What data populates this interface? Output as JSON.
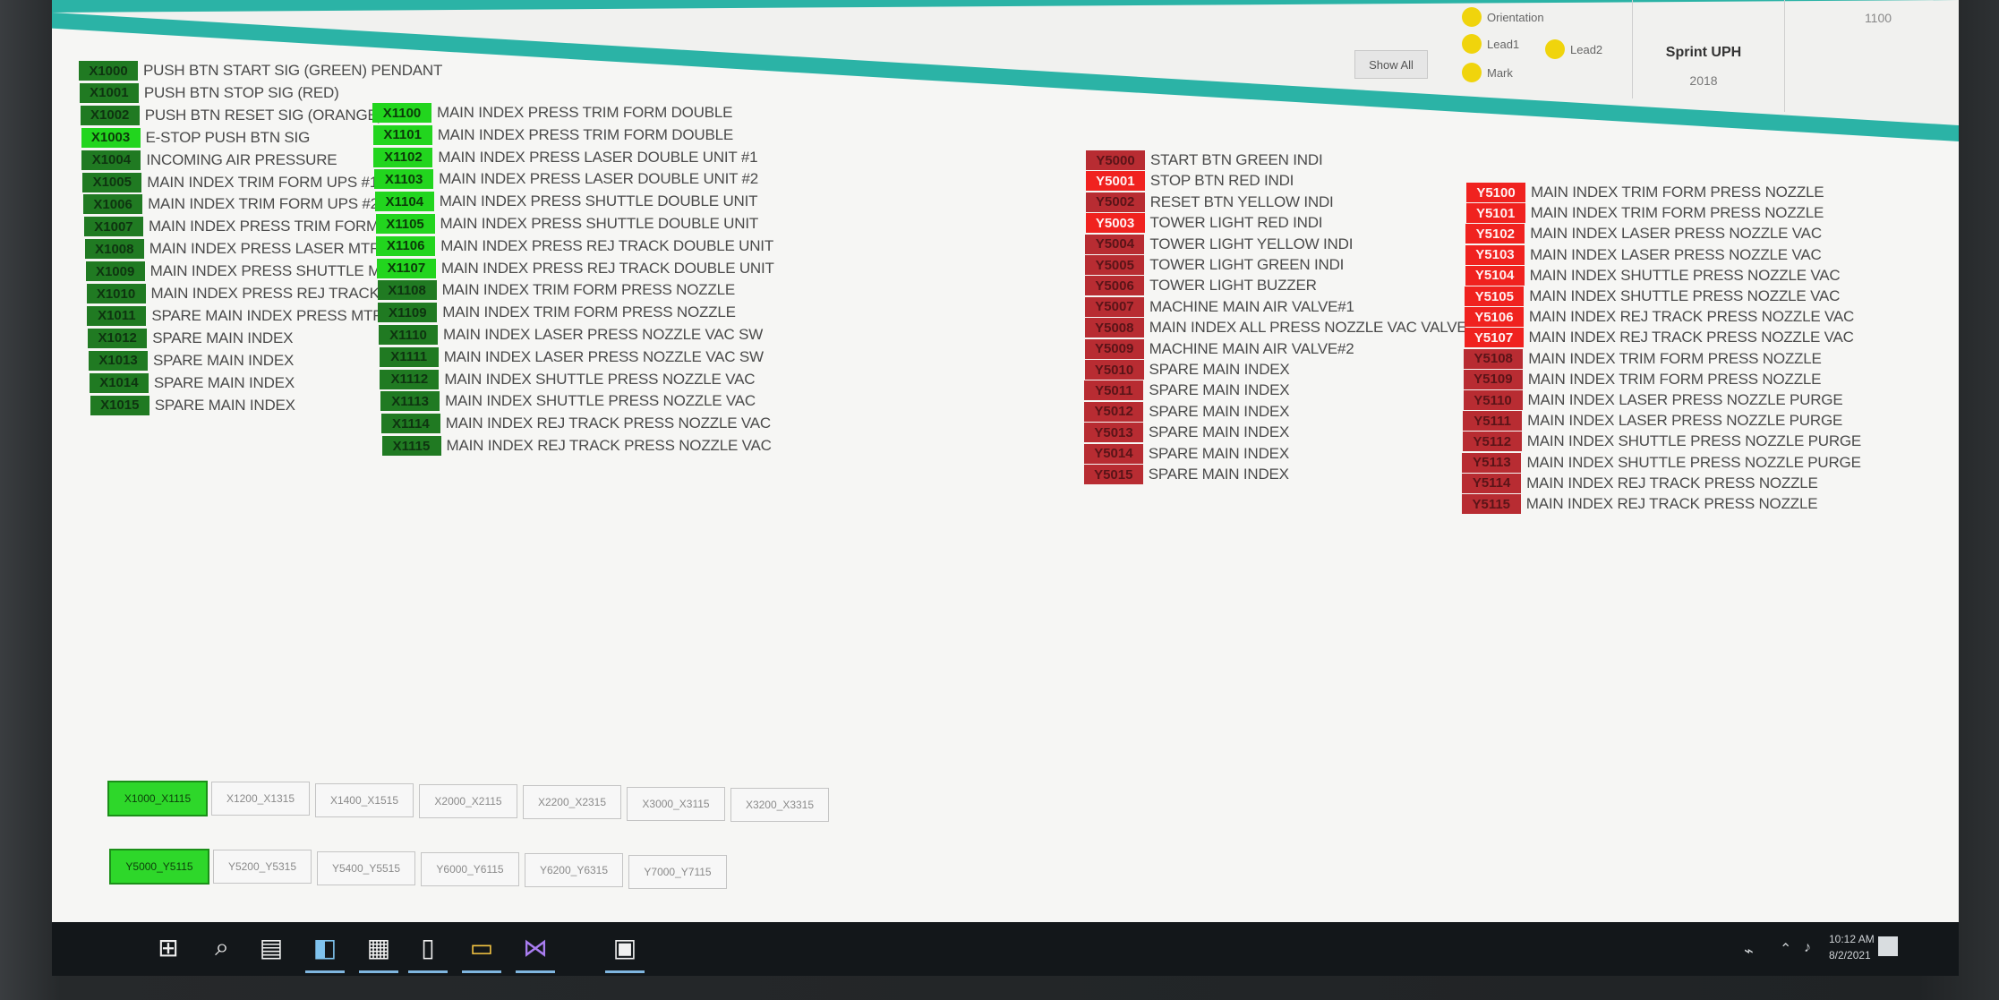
{
  "header": {
    "show_all_label": "Show All",
    "legend": [
      "Orientation",
      "Lead1",
      "Lead2",
      "Mark"
    ],
    "sprint_label": "Sprint UPH",
    "sprint_value": "2018",
    "top_value": "1100"
  },
  "colors": {
    "teal": "#2bb3a6",
    "input_on": "#22d51e",
    "input_off": "#207a22",
    "output_on": "#f0221f",
    "output_off": "#b82c32"
  },
  "col1": [
    {
      "tag": "X1000",
      "label": "PUSH BTN START SIG (GREEN)  PENDANT",
      "state": "off"
    },
    {
      "tag": "X1001",
      "label": "PUSH BTN STOP SIG (RED)",
      "state": "off"
    },
    {
      "tag": "X1002",
      "label": "PUSH BTN RESET SIG (ORANGE)",
      "state": "off"
    },
    {
      "tag": "X1003",
      "label": "E-STOP PUSH BTN SIG",
      "state": "on"
    },
    {
      "tag": "X1004",
      "label": "INCOMING AIR PRESSURE",
      "state": "off"
    },
    {
      "tag": "X1005",
      "label": "MAIN INDEX TRIM  FORM UPS #1",
      "state": "off"
    },
    {
      "tag": "X1006",
      "label": "MAIN INDEX TRIM  FORM UPS #2",
      "state": "off"
    },
    {
      "tag": "X1007",
      "label": "MAIN INDEX PRESS TRIM  FORM MTR",
      "state": "off"
    },
    {
      "tag": "X1008",
      "label": "MAIN INDEX PRESS LASER MTR",
      "state": "off"
    },
    {
      "tag": "X1009",
      "label": "MAIN INDEX PRESS SHUTTLE MTR",
      "state": "off"
    },
    {
      "tag": "X1010",
      "label": "MAIN INDEX PRESS REJ TRACK MTR",
      "state": "off"
    },
    {
      "tag": "X1011",
      "label": "SPARE MAIN INDEX PRESS MTR",
      "state": "off"
    },
    {
      "tag": "X1012",
      "label": "SPARE MAIN INDEX",
      "state": "off"
    },
    {
      "tag": "X1013",
      "label": "SPARE MAIN INDEX",
      "state": "off"
    },
    {
      "tag": "X1014",
      "label": "SPARE MAIN INDEX",
      "state": "off"
    },
    {
      "tag": "X1015",
      "label": "SPARE MAIN INDEX",
      "state": "off"
    }
  ],
  "col2": [
    {
      "tag": "X1100",
      "label": "MAIN INDEX PRESS TRIM  FORM DOUBLE",
      "state": "on"
    },
    {
      "tag": "X1101",
      "label": "MAIN INDEX PRESS TRIM  FORM DOUBLE",
      "state": "on"
    },
    {
      "tag": "X1102",
      "label": "MAIN INDEX PRESS LASER DOUBLE UNIT #1",
      "state": "on"
    },
    {
      "tag": "X1103",
      "label": "MAIN INDEX PRESS LASER DOUBLE UNIT #2",
      "state": "on"
    },
    {
      "tag": "X1104",
      "label": "MAIN INDEX PRESS SHUTTLE DOUBLE UNIT",
      "state": "on"
    },
    {
      "tag": "X1105",
      "label": "MAIN INDEX PRESS SHUTTLE DOUBLE UNIT",
      "state": "on"
    },
    {
      "tag": "X1106",
      "label": "MAIN INDEX PRESS REJ TRACK DOUBLE UNIT",
      "state": "on"
    },
    {
      "tag": "X1107",
      "label": "MAIN INDEX PRESS REJ TRACK DOUBLE UNIT",
      "state": "on"
    },
    {
      "tag": "X1108",
      "label": "MAIN INDEX TRIM  FORM PRESS NOZZLE",
      "state": "off"
    },
    {
      "tag": "X1109",
      "label": "MAIN INDEX TRIM  FORM PRESS NOZZLE",
      "state": "off"
    },
    {
      "tag": "X1110",
      "label": "MAIN INDEX LASER PRESS NOZZLE VAC SW",
      "state": "off"
    },
    {
      "tag": "X1111",
      "label": "MAIN INDEX LASER PRESS NOZZLE VAC SW",
      "state": "off"
    },
    {
      "tag": "X1112",
      "label": "MAIN INDEX SHUTTLE PRESS NOZZLE VAC",
      "state": "off"
    },
    {
      "tag": "X1113",
      "label": "MAIN INDEX SHUTTLE PRESS NOZZLE VAC",
      "state": "off"
    },
    {
      "tag": "X1114",
      "label": "MAIN INDEX REJ TRACK PRESS NOZZLE VAC",
      "state": "off"
    },
    {
      "tag": "X1115",
      "label": "MAIN INDEX REJ TRACK PRESS NOZZLE VAC",
      "state": "off"
    }
  ],
  "col3": [
    {
      "tag": "Y5000",
      "label": "START BTN GREEN INDI",
      "state": "off"
    },
    {
      "tag": "Y5001",
      "label": "STOP BTN RED INDI",
      "state": "on"
    },
    {
      "tag": "Y5002",
      "label": "RESET BTN YELLOW INDI",
      "state": "off"
    },
    {
      "tag": "Y5003",
      "label": "TOWER LIGHT RED INDI",
      "state": "on"
    },
    {
      "tag": "Y5004",
      "label": "TOWER LIGHT YELLOW INDI",
      "state": "off"
    },
    {
      "tag": "Y5005",
      "label": "TOWER LIGHT GREEN INDI",
      "state": "off"
    },
    {
      "tag": "Y5006",
      "label": "TOWER LIGHT BUZZER",
      "state": "off"
    },
    {
      "tag": "Y5007",
      "label": "MACHINE MAIN AIR VALVE#1",
      "state": "off"
    },
    {
      "tag": "Y5008",
      "label": "MAIN INDEX ALL PRESS NOZZLE VAC VALVE",
      "state": "off"
    },
    {
      "tag": "Y5009",
      "label": "MACHINE MAIN AIR VALVE#2",
      "state": "off"
    },
    {
      "tag": "Y5010",
      "label": "SPARE MAIN INDEX",
      "state": "off"
    },
    {
      "tag": "Y5011",
      "label": "SPARE MAIN INDEX",
      "state": "off"
    },
    {
      "tag": "Y5012",
      "label": "SPARE MAIN INDEX",
      "state": "off"
    },
    {
      "tag": "Y5013",
      "label": "SPARE MAIN INDEX",
      "state": "off"
    },
    {
      "tag": "Y5014",
      "label": "SPARE MAIN INDEX",
      "state": "off"
    },
    {
      "tag": "Y5015",
      "label": "SPARE MAIN INDEX",
      "state": "off"
    }
  ],
  "col4": [
    {
      "tag": "Y5100",
      "label": "MAIN INDEX TRIM  FORM PRESS NOZZLE",
      "state": "on"
    },
    {
      "tag": "Y5101",
      "label": "MAIN INDEX TRIM  FORM PRESS NOZZLE",
      "state": "on"
    },
    {
      "tag": "Y5102",
      "label": "MAIN INDEX LASER PRESS NOZZLE VAC",
      "state": "on"
    },
    {
      "tag": "Y5103",
      "label": "MAIN INDEX LASER PRESS NOZZLE VAC",
      "state": "on"
    },
    {
      "tag": "Y5104",
      "label": "MAIN INDEX SHUTTLE PRESS NOZZLE VAC",
      "state": "on"
    },
    {
      "tag": "Y5105",
      "label": "MAIN INDEX SHUTTLE PRESS NOZZLE VAC",
      "state": "on"
    },
    {
      "tag": "Y5106",
      "label": "MAIN INDEX REJ TRACK PRESS NOZZLE VAC",
      "state": "on"
    },
    {
      "tag": "Y5107",
      "label": "MAIN INDEX REJ TRACK PRESS NOZZLE VAC",
      "state": "on"
    },
    {
      "tag": "Y5108",
      "label": "MAIN INDEX TRIM  FORM PRESS NOZZLE",
      "state": "off"
    },
    {
      "tag": "Y5109",
      "label": "MAIN INDEX TRIM  FORM PRESS NOZZLE",
      "state": "off"
    },
    {
      "tag": "Y5110",
      "label": "MAIN INDEX LASER PRESS NOZZLE PURGE",
      "state": "off"
    },
    {
      "tag": "Y5111",
      "label": "MAIN INDEX LASER PRESS NOZZLE PURGE",
      "state": "off"
    },
    {
      "tag": "Y5112",
      "label": "MAIN INDEX SHUTTLE PRESS NOZZLE PURGE",
      "state": "off"
    },
    {
      "tag": "Y5113",
      "label": "MAIN INDEX SHUTTLE PRESS NOZZLE PURGE",
      "state": "off"
    },
    {
      "tag": "Y5114",
      "label": "MAIN INDEX REJ TRACK PRESS NOZZLE",
      "state": "off"
    },
    {
      "tag": "Y5115",
      "label": "MAIN INDEX REJ TRACK PRESS NOZZLE",
      "state": "off"
    }
  ],
  "pages_x": [
    {
      "label": "X1000_X1115",
      "active": true
    },
    {
      "label": "X1200_X1315",
      "active": false
    },
    {
      "label": "X1400_X1515",
      "active": false
    },
    {
      "label": "X2000_X2115",
      "active": false
    },
    {
      "label": "X2200_X2315",
      "active": false
    },
    {
      "label": "X3000_X3115",
      "active": false
    },
    {
      "label": "X3200_X3315",
      "active": false
    }
  ],
  "pages_y": [
    {
      "label": "Y5000_Y5115",
      "active": true
    },
    {
      "label": "Y5200_Y5315",
      "active": false
    },
    {
      "label": "Y5400_Y5515",
      "active": false
    },
    {
      "label": "Y6000_Y6115",
      "active": false
    },
    {
      "label": "Y6200_Y6315",
      "active": false
    },
    {
      "label": "Y7000_Y7115",
      "active": false
    }
  ],
  "taskbar": {
    "icons": [
      "windows-start-icon",
      "search-icon",
      "task-view-icon",
      "app-icon",
      "grid-app-icon",
      "phone-app-icon",
      "file-explorer-icon",
      "visual-studio-icon",
      "terminal-app-icon"
    ],
    "time": "10:12 AM",
    "date": "8/2/2021"
  }
}
